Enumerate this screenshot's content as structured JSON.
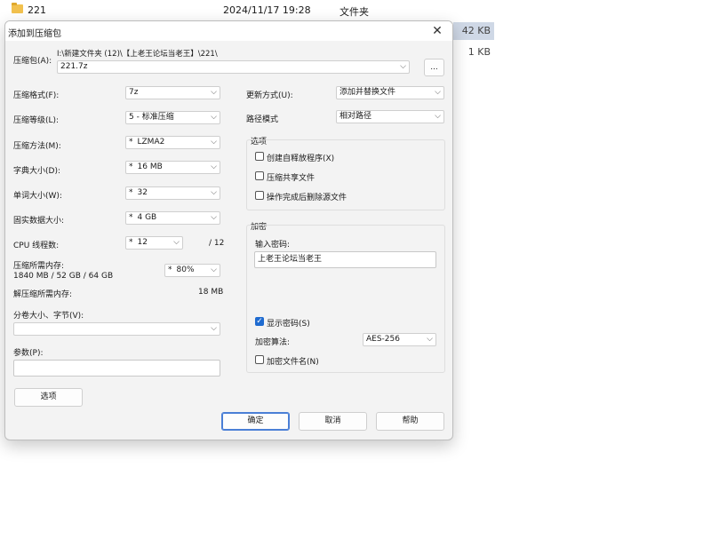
{
  "explorer": {
    "row1": {
      "name": "221",
      "date": "2024/11/17 19:28",
      "type": "文件夹"
    },
    "sizes": [
      "42 KB",
      "1 KB"
    ]
  },
  "dialog": {
    "title": "添加到压缩包",
    "archive": {
      "label": "压缩包(A):",
      "path": "I:\\新建文件夹 (12)\\【上老王论坛当老王】\\221\\",
      "filename": "221.7z",
      "browse": "..."
    },
    "left": {
      "format": {
        "label": "压缩格式(F):",
        "value": "7z"
      },
      "level": {
        "label": "压缩等级(L):",
        "value": "5 - 标准压缩"
      },
      "method": {
        "label": "压缩方法(M):",
        "value": "LZMA2"
      },
      "dict": {
        "label": "字典大小(D):",
        "value": "16 MB"
      },
      "word": {
        "label": "单词大小(W):",
        "value": "32"
      },
      "solid": {
        "label": "固实数据大小:",
        "value": "4 GB"
      },
      "cpu": {
        "label": "CPU 线程数:",
        "value": "12",
        "total": "/ 12"
      },
      "mem_comp": {
        "label": "压缩所需内存:",
        "detail": "1840 MB / 52 GB / 64 GB",
        "value": "80%"
      },
      "mem_decomp": {
        "label": "解压缩所需内存:",
        "value": "18 MB"
      },
      "volume": {
        "label": "分卷大小、字节(V):",
        "value": ""
      },
      "params": {
        "label": "参数(P):",
        "value": ""
      },
      "options_btn": "选项"
    },
    "right": {
      "update": {
        "label": "更新方式(U):",
        "value": "添加并替换文件"
      },
      "pathmode": {
        "label": "路径模式",
        "value": "相对路径"
      },
      "options": {
        "title": "选项",
        "sfx": "创建自释放程序(X)",
        "shared": "压缩共享文件",
        "delete": "操作完成后删除源文件"
      },
      "encryption": {
        "title": "加密",
        "pw_label": "输入密码:",
        "password": "上老王论坛当老王",
        "show_pw": "显示密码(S)",
        "method_label": "加密算法:",
        "method": "AES-256",
        "encrypt_names": "加密文件名(N)"
      }
    },
    "buttons": {
      "ok": "确定",
      "cancel": "取消",
      "help": "帮助"
    },
    "star": "*"
  }
}
